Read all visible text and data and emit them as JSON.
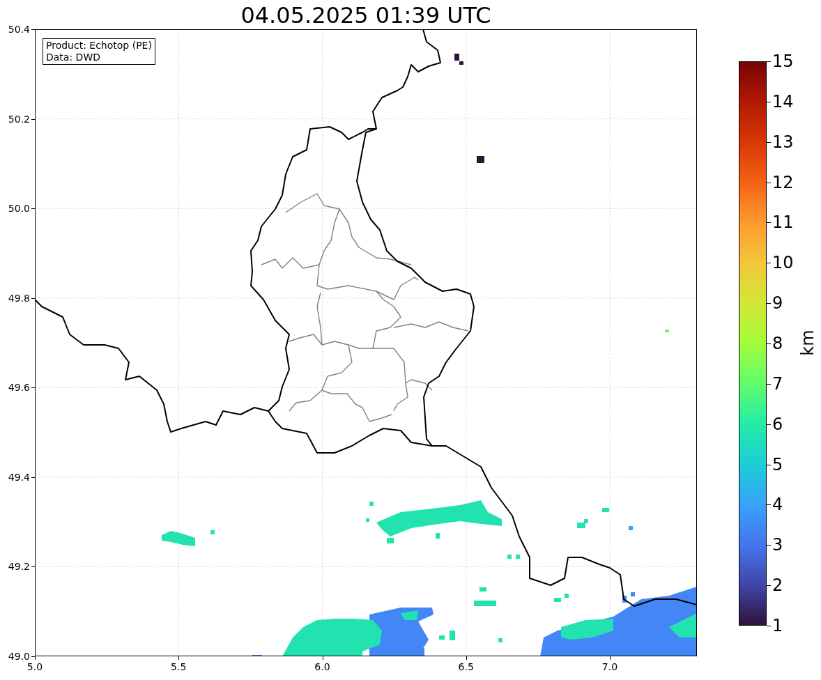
{
  "title": "04.05.2025 01:39 UTC",
  "info_box": [
    "Product: Echotop (PE)",
    "Data: DWD"
  ],
  "map": {
    "y_ticks": [
      "50.4",
      "50.2",
      "50.0",
      "49.8",
      "49.6",
      "49.4",
      "49.2",
      "49.0"
    ],
    "x_ticks": [
      "5.0",
      "5.5",
      "6.0",
      "6.5",
      "7.0"
    ]
  },
  "colorbar": {
    "ticks": [
      "15",
      "14",
      "13",
      "12",
      "11",
      "10",
      "9",
      "8",
      "7",
      "6",
      "5",
      "4",
      "3",
      "2",
      "1"
    ],
    "label": "km"
  }
}
